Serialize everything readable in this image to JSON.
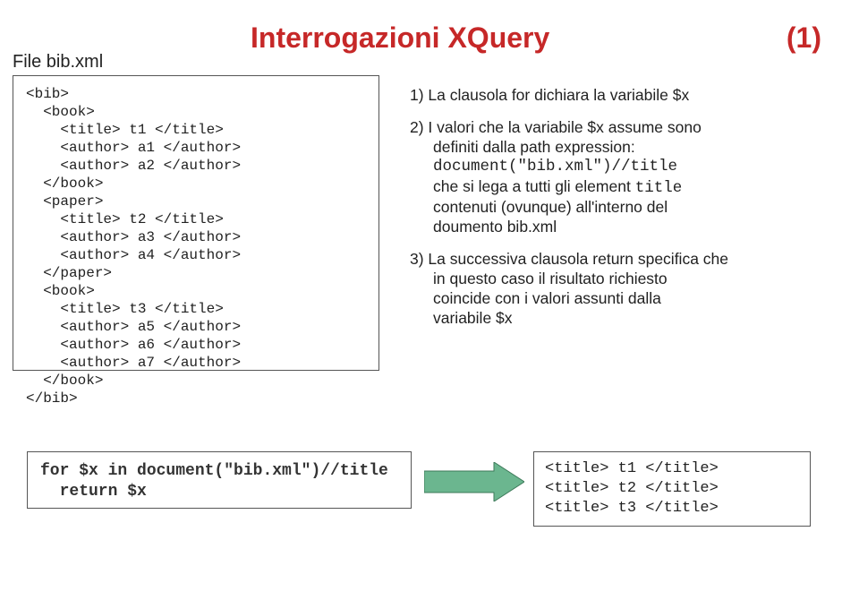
{
  "header": {
    "file_label": "File bib.xml",
    "title": "Interrogazioni XQuery",
    "slide_num": "(1)"
  },
  "xml_content": "<bib>\n  <book>\n    <title> t1 </title>\n    <author> a1 </author>\n    <author> a2 </author>\n  </book>\n  <paper>\n    <title> t2 </title>\n    <author> a3 </author>\n    <author> a4 </author>\n  </paper>\n  <book>\n    <title> t3 </title>\n    <author> a5 </author>\n    <author> a6 </author>\n    <author> a7 </author>\n  </book>\n</bib>",
  "explain": {
    "n1_lead": "1) La clausola for dichiara la variabile $x",
    "n2_lead": "2) I valori che la variabile $x assume sono",
    "n2_l2": "definiti dalla path expression:",
    "n2_code": "document(\"bib.xml\")//title",
    "n2_l4a": "che si lega a tutti gli element ",
    "n2_l4b": "title",
    "n2_l5": "contenuti (ovunque) all'interno del",
    "n2_l6": "doumento bib.xml",
    "n3_lead": "3) La successiva clausola return specifica che",
    "n3_l2": "in questo caso il risultato richiesto",
    "n3_l3": "coincide con i valori assunti dalla",
    "n3_l4": "variabile $x"
  },
  "query": "for $x in document(\"bib.xml\")//title\n  return $x",
  "result": "<title> t1 </title>\n<title> t2 </title>\n<title> t3 </title>"
}
